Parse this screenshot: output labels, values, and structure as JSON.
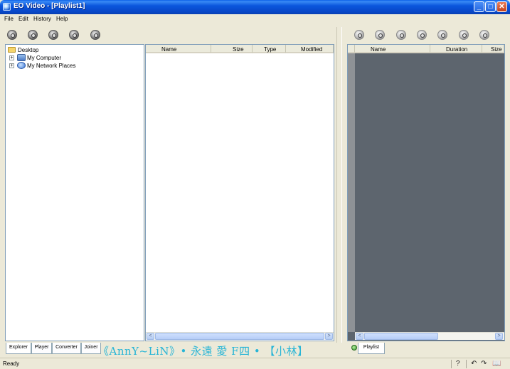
{
  "window": {
    "title": "EO Video - [Playlist1]",
    "buttons": {
      "minimize": "_",
      "maximize": "□",
      "close": "✕"
    }
  },
  "menu": {
    "items": [
      "File",
      "Edit",
      "History",
      "Help"
    ]
  },
  "toolbar_left": {
    "icons": [
      "search-icon",
      "stop-icon",
      "burn-icon",
      "settings-icon",
      "record-icon"
    ]
  },
  "toolbar_right": {
    "icons": [
      "add-icon",
      "settings-icon",
      "eye-icon",
      "remove-icon",
      "clear-icon",
      "play-icon",
      "refresh-icon"
    ]
  },
  "tree": {
    "items": [
      {
        "label": "Desktop",
        "icon": "folder-icon",
        "expander": ""
      },
      {
        "label": "My Computer",
        "icon": "computer-icon",
        "expander": "+"
      },
      {
        "label": "My Network Places",
        "icon": "network-icon",
        "expander": "+"
      }
    ]
  },
  "file_list": {
    "columns": [
      "Name",
      "Size",
      "Type",
      "Modified"
    ],
    "scroll_left": "<",
    "scroll_right": ">"
  },
  "playlist": {
    "columns": [
      "Name",
      "Duration",
      "Size"
    ],
    "scroll_left": "<",
    "scroll_right": ">"
  },
  "tabs": {
    "left": [
      "Explorer",
      "Player",
      "Converter",
      "Joiner"
    ],
    "right": [
      "Playlist"
    ]
  },
  "watermark": "《AnnY~LiN》• 永遠 愛 F四  • 【小林】",
  "status": {
    "text": "Ready",
    "icons": {
      "help": "?",
      "undo": "↶",
      "redo": "↷",
      "book": "📖"
    }
  },
  "colors": {
    "titlebar": "#0a5ee8",
    "playlist_bg": "#5d656e",
    "watermark": "#28b5d6"
  }
}
